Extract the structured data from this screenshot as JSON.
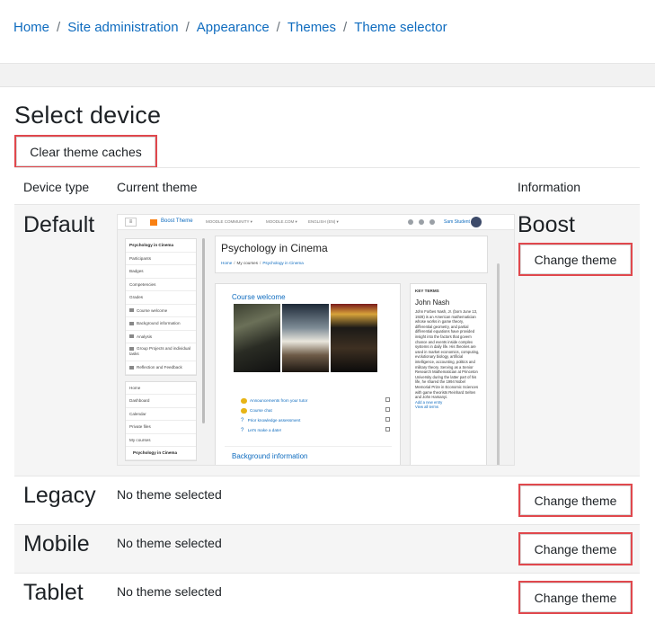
{
  "breadcrumb": [
    "Home",
    "Site administration",
    "Appearance",
    "Themes",
    "Theme selector"
  ],
  "page": {
    "title": "Select device",
    "clear_caches_label": "Clear theme caches"
  },
  "table": {
    "headers": [
      "Device type",
      "Current theme",
      "Information"
    ],
    "change_label": "Change theme",
    "no_theme_label": "No theme selected",
    "rows": [
      {
        "device": "Default",
        "theme": "Boost"
      },
      {
        "device": "Legacy"
      },
      {
        "device": "Mobile"
      },
      {
        "device": "Tablet"
      }
    ]
  },
  "preview": {
    "brand": "Boost Theme",
    "menu": [
      "MOODLE COMMUNITY ▾",
      "MOODLE.COM ▾",
      "ENGLISH (EN) ▾"
    ],
    "user": "Sam Student",
    "course_title": "Psychology in Cinema",
    "crumbs": [
      "Home",
      "My courses",
      "Psychology in Cinema"
    ],
    "drawer_top": [
      "Psychology in Cinema",
      "Participants",
      "Badges",
      "Competencies",
      "Grades"
    ],
    "drawer_folders": [
      "Course welcome",
      "Background information",
      "Analysis",
      "Group Projects and individual tasks",
      "Reflection and Feedback"
    ],
    "drawer_bottom": [
      "Home",
      "Dashboard",
      "Calendar",
      "Private files",
      "My courses",
      "Psychology in Cinema"
    ],
    "section1": "Course welcome",
    "section2": "Background information",
    "activities": [
      "Announcements from your tutor",
      "Course chat",
      "Prior knowledge assessment",
      "Let's make a date!"
    ],
    "block": {
      "title": "KEY TERMS",
      "name": "John Nash",
      "text": "John Forbes Nash, Jr. (born June 13, 1928) is an American mathematician whose works in game theory, differential geometry, and partial differential equations have provided insight into the factors that govern chance and events inside complex systems in daily life. His theories are used in market economics, computing, evolutionary biology, artificial intelligence, accounting, politics and military theory. Serving as a Senior Research Mathematician at Princeton University during the latter part of his life, he shared the 1994 Nobel Memorial Prize in Economic Sciences with game theorists Reinhard Selten and John Harsanyi.",
      "links": [
        "Add a new entry",
        "View all terms"
      ]
    }
  }
}
